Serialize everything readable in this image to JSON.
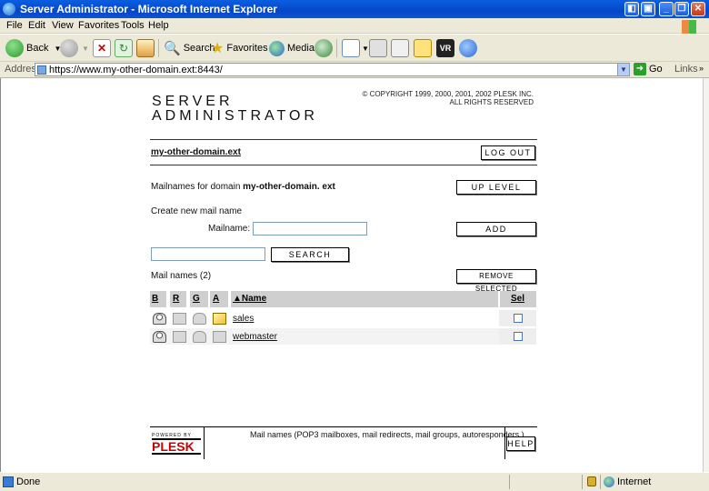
{
  "window": {
    "title": "Server Administrator - Microsoft Internet Explorer"
  },
  "menu": [
    "File",
    "Edit",
    "View",
    "Favorites",
    "Tools",
    "Help"
  ],
  "toolbar": {
    "back": "Back",
    "search": "Search",
    "favorites": "Favorites",
    "media": "Media"
  },
  "address": {
    "label": "Address",
    "url": "https://www.my-other-domain.ext:8443/",
    "go": "Go",
    "links": "Links"
  },
  "page": {
    "logo_line1": "SERVER",
    "logo_line2": "ADMINISTRATOR",
    "copyright_line1": "© COPYRIGHT 1999, 2000, 2001, 2002 PLESK INC.",
    "copyright_line2": "ALL RIGHTS RESERVED",
    "domain": "my-other-domain.ext",
    "logout": "LOG OUT",
    "mailnames_prefix": "Mailnames for domain ",
    "mailnames_domain": "my-other-domain. ext",
    "up_level": "UP LEVEL",
    "create_label": "Create new mail name",
    "mailname_label": "Mailname:",
    "mailname_value": "",
    "add": "ADD",
    "search_value": "",
    "search": "SEARCH",
    "mail_names_count": "Mail names (2)",
    "remove_selected": "REMOVE SELECTED"
  },
  "table": {
    "headers": {
      "b": "B",
      "r": "R",
      "g": "G",
      "a": "A",
      "name": "▲Name",
      "sel": "Sel"
    },
    "rows": [
      {
        "name": "sales",
        "selected": false,
        "autoresponder": true
      },
      {
        "name": "webmaster",
        "selected": false,
        "autoresponder": false
      }
    ]
  },
  "footer": {
    "powered_by": "POWERED BY",
    "plesk": "PLESK",
    "help_text": "Mail names (POP3 mailboxes, mail redirects, mail groups, autoresponders.)",
    "help": "HELP"
  },
  "status": {
    "text": "Done",
    "zone": "Internet"
  }
}
